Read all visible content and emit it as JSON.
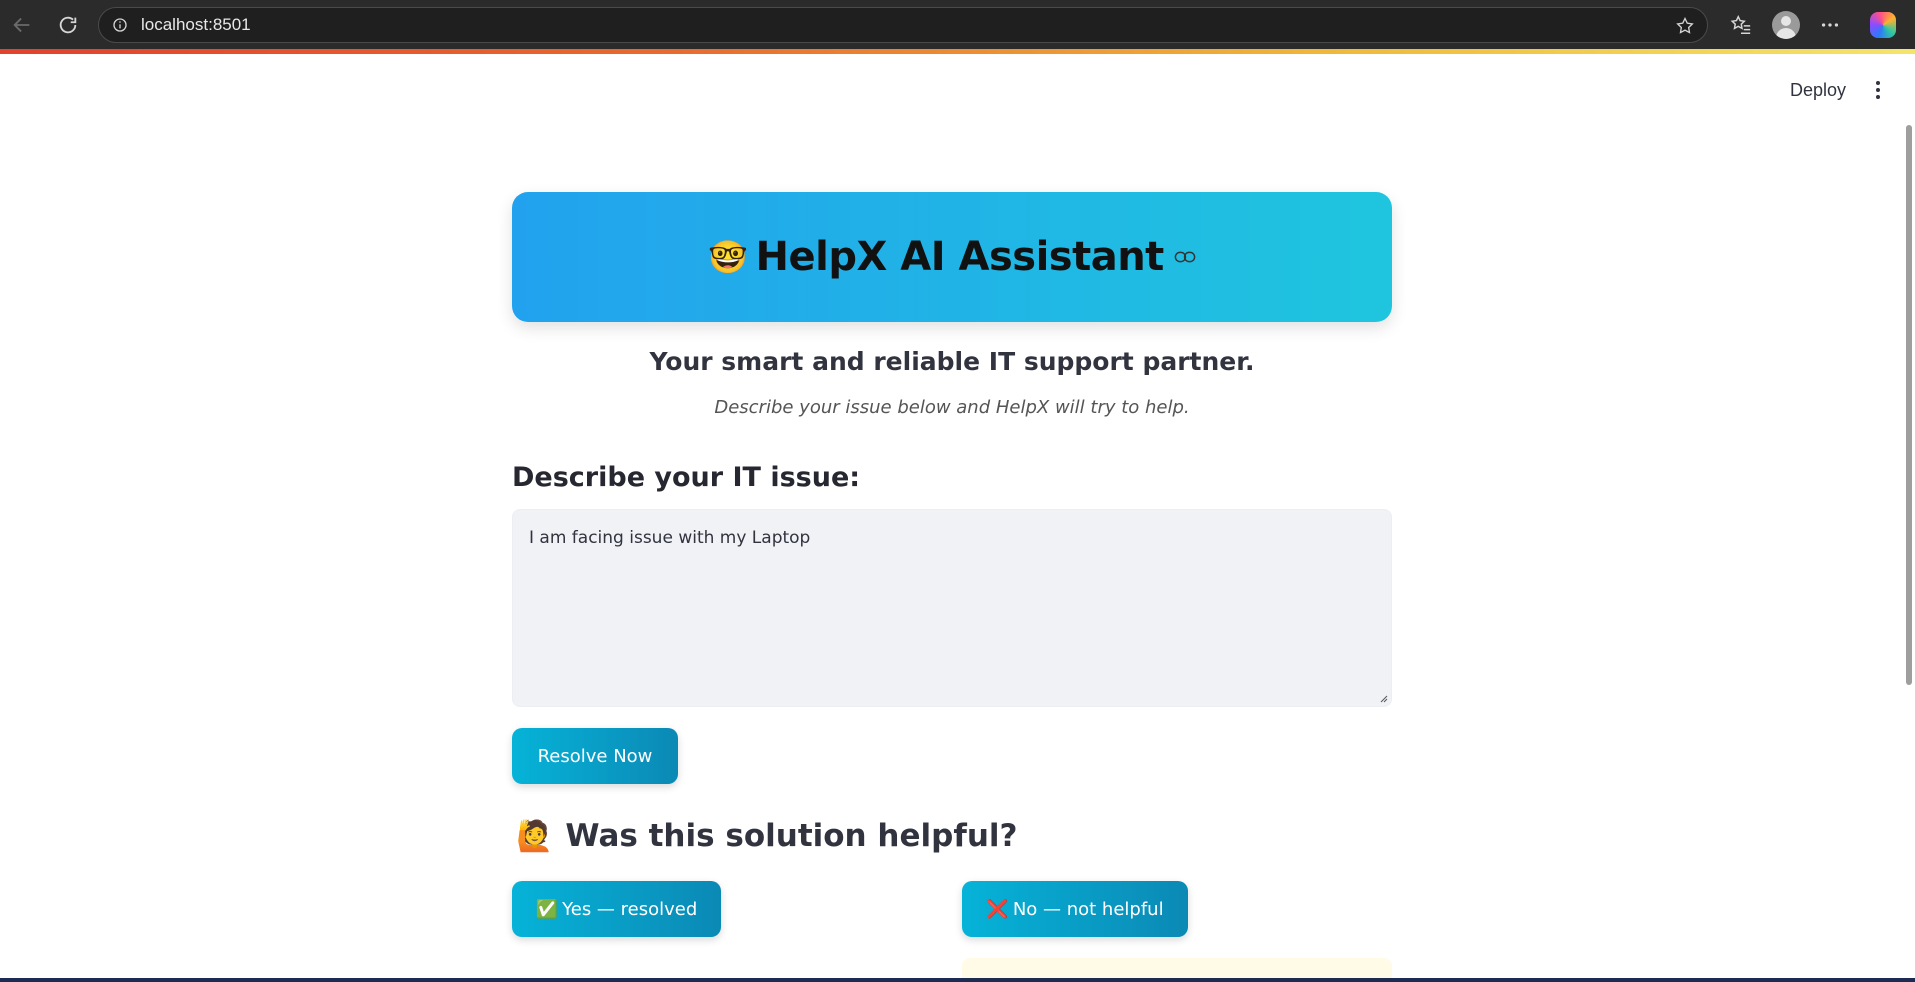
{
  "browser": {
    "url": "localhost:8501",
    "icons": [
      "back-icon",
      "reload-icon",
      "info-icon",
      "star-icon",
      "favorites-icon",
      "profile-icon",
      "more-icon",
      "copilot-icon"
    ]
  },
  "toolbar": {
    "deploy_label": "Deploy"
  },
  "hero": {
    "emoji": "🤓",
    "title": "HelpX AI Assistant",
    "gradient": [
      "#22a2ee",
      "#1fc5de"
    ]
  },
  "subtitle": "Your smart and reliable IT support partner.",
  "tagline": "Describe your issue below and HelpX will try to help.",
  "issue": {
    "label": "Describe your IT issue:",
    "value": "I am facing issue with my Laptop"
  },
  "actions": {
    "resolve_label": "Resolve Now"
  },
  "feedback": {
    "emoji": "🙋",
    "heading": "Was this solution helpful?",
    "yes_emoji": "✅",
    "yes_label": "Yes — resolved",
    "no_emoji": "❌",
    "no_label": "No — not helpful"
  },
  "colors": {
    "button": "#0b9cc7",
    "accent_bar": "#e86a2e"
  }
}
